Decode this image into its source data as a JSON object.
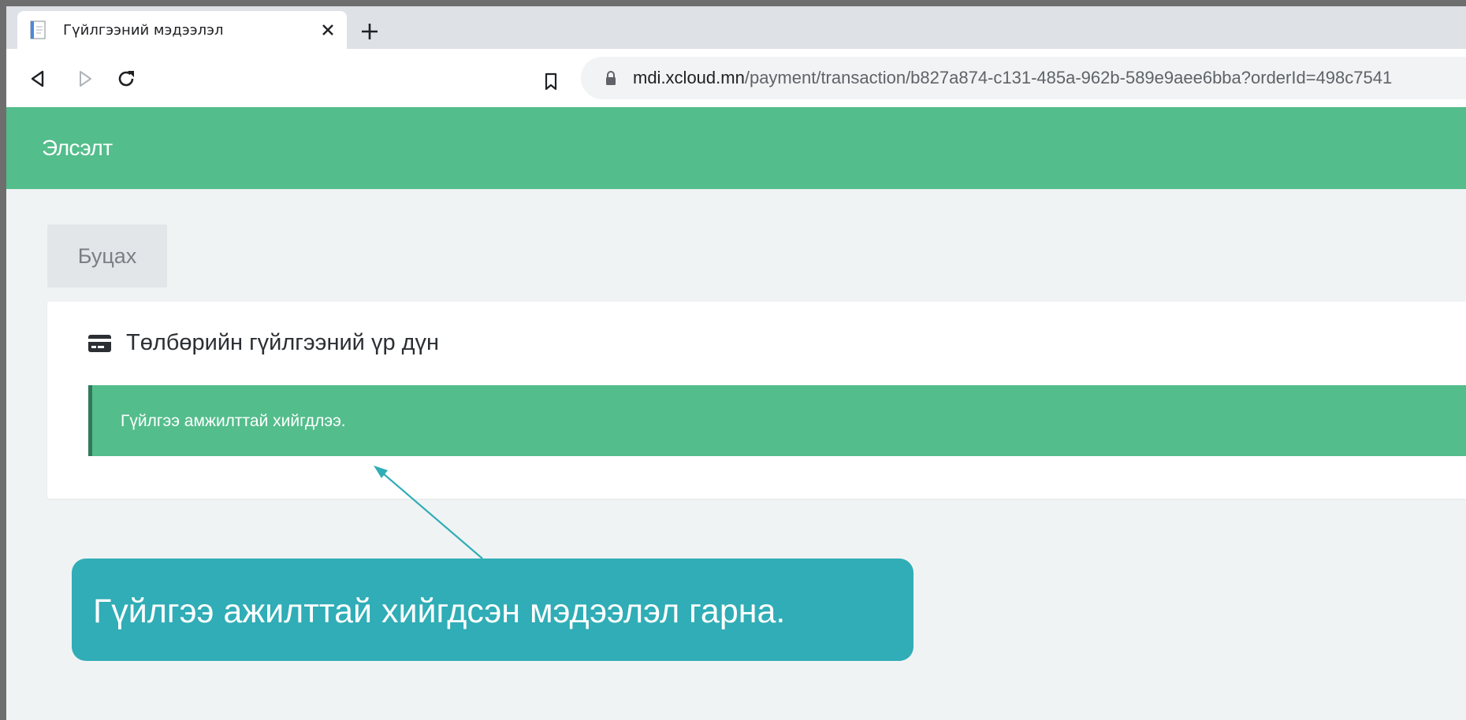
{
  "browser": {
    "tab_title": "Гүйлгээний мэдээлэл",
    "url_host": "mdi.xcloud.mn",
    "url_rest": "/payment/transaction/b827a874-c131-485a-962b-589e9aee6bba?orderId=498c7541"
  },
  "app": {
    "header_title": "Элсэлт",
    "back_label": "Буцах"
  },
  "card": {
    "title": "Төлбөрийн гүйлгээний үр дүн",
    "alert_message": "Гүйлгээ амжилттай хийгдлээ."
  },
  "annotation": {
    "callout_text": "Гүйлгээ ажилттай хийгдсэн мэдээлэл гарна."
  },
  "colors": {
    "accent_green": "#53bd8c",
    "callout_teal": "#30adb6"
  },
  "icons": {
    "favicon": "document-icon",
    "close": "close-icon",
    "new_tab": "plus-icon",
    "back": "back-arrow-icon",
    "forward": "forward-arrow-icon",
    "reload": "reload-icon",
    "bookmark": "bookmark-icon",
    "lock": "lock-icon",
    "card": "credit-card-icon"
  }
}
